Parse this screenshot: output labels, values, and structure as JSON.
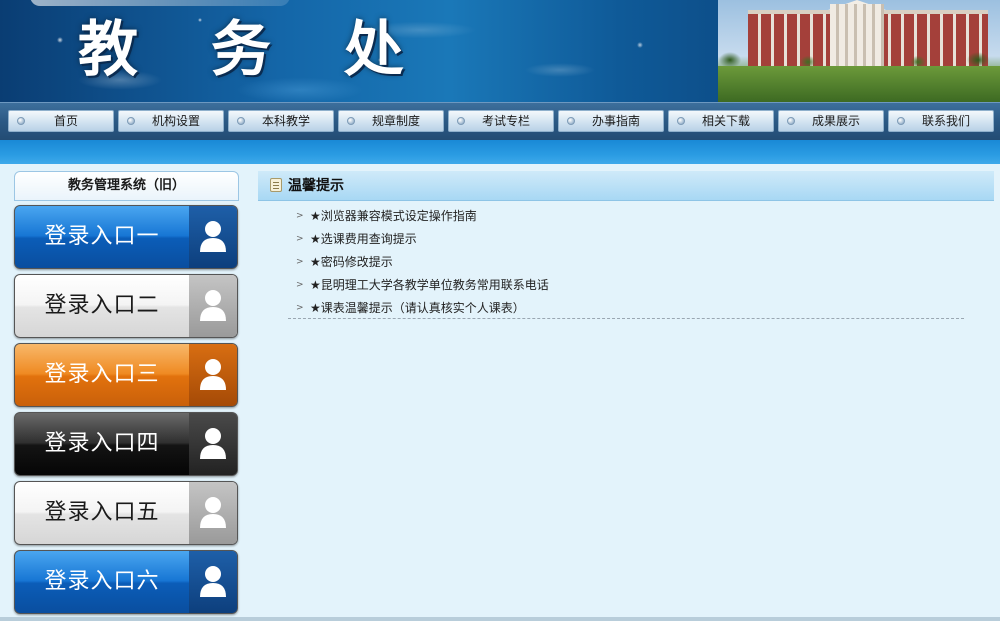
{
  "banner": {
    "title": "教 务 处"
  },
  "nav": {
    "items": [
      {
        "label": "首页"
      },
      {
        "label": "机构设置"
      },
      {
        "label": "本科教学"
      },
      {
        "label": "规章制度"
      },
      {
        "label": "考试专栏"
      },
      {
        "label": "办事指南"
      },
      {
        "label": "相关下载"
      },
      {
        "label": "成果展示"
      },
      {
        "label": "联系我们"
      }
    ]
  },
  "sidebar": {
    "title": "教务管理系统（旧）",
    "buttons": [
      {
        "label": "登录入口一",
        "color": "#0b5db8"
      },
      {
        "label": "登录入口二",
        "color": "#e4e4e4"
      },
      {
        "label": "登录入口三",
        "color": "#e2720d"
      },
      {
        "label": "登录入口四",
        "color": "#141414"
      },
      {
        "label": "登录入口五",
        "color": "#e4e4e4"
      },
      {
        "label": "登录入口六",
        "color": "#0b5db8"
      }
    ],
    "icon": "user-icon"
  },
  "panel": {
    "title": "温馨提示",
    "notices": [
      {
        "text": "★浏览器兼容模式设定操作指南"
      },
      {
        "text": "★选课费用查询提示"
      },
      {
        "text": "★密码修改提示"
      },
      {
        "text": "★昆明理工大学各教学单位教务常用联系电话"
      },
      {
        "text": "★课表温馨提示（请认真核实个人课表）"
      }
    ]
  }
}
